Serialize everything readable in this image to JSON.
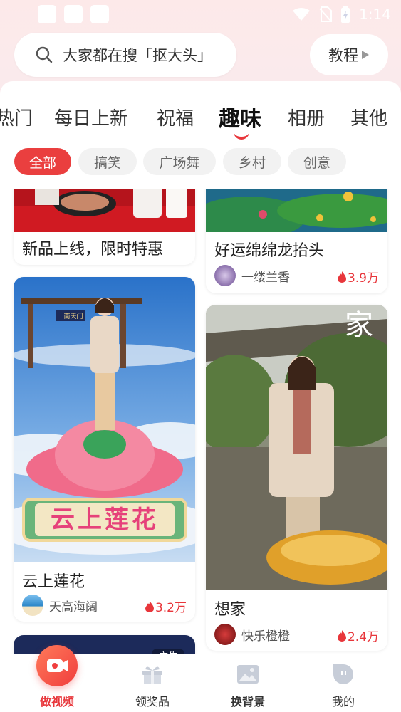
{
  "status_bar": {
    "time": "1:14"
  },
  "search": {
    "placeholder": "大家都在搜「抠大头」"
  },
  "tutorial": {
    "label": "教程"
  },
  "tabs": [
    {
      "label": "热门"
    },
    {
      "label": "每日上新"
    },
    {
      "label": "祝福"
    },
    {
      "label": "趣味",
      "active": true
    },
    {
      "label": "相册"
    },
    {
      "label": "其他"
    }
  ],
  "chips": [
    {
      "label": "全部",
      "active": true
    },
    {
      "label": "搞笑"
    },
    {
      "label": "广场舞"
    },
    {
      "label": "乡村"
    },
    {
      "label": "创意"
    }
  ],
  "cards": {
    "promo": {
      "title": "新品上线，限时特惠"
    },
    "lucky": {
      "title": "好运绵绵龙抬头",
      "author": "一缕兰香",
      "likes": "3.9万"
    },
    "lotus": {
      "title": "云上莲花",
      "overlay": "云上莲花",
      "gate": "南天门",
      "author": "天高海阔",
      "likes": "3.2万"
    },
    "home": {
      "title": "想家",
      "overlay": "家",
      "author": "快乐橙橙",
      "likes": "2.4万"
    },
    "ad": {
      "tag": "广告"
    }
  },
  "bottom_nav": [
    {
      "label": "做视频",
      "active": true
    },
    {
      "label": "领奖品"
    },
    {
      "label": "换背景"
    },
    {
      "label": "我的"
    }
  ],
  "colors": {
    "accent": "#e8363b",
    "chip_active": "#ea3f3f"
  }
}
